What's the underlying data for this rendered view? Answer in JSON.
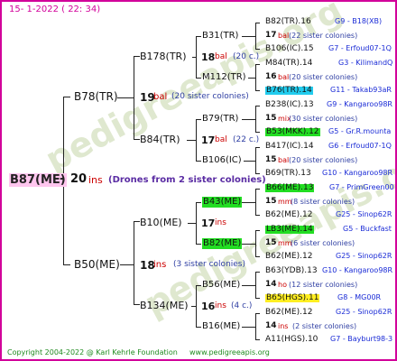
{
  "header": {
    "date": "15-  1-2022 ( 22: 34)"
  },
  "watermark": {
    "bg_text": "pedigreeapis.org"
  },
  "subject": {
    "name": "B87(ME)",
    "number": "20",
    "sep": "-",
    "abbr": "ins",
    "note": "(Drones from 2 sister colonies)"
  },
  "gen1": [
    {
      "name": "B78(TR)",
      "number": "19",
      "abbr": "bal",
      "note": "(20 sister colonies)"
    },
    {
      "name": "B50(ME)",
      "number": "18",
      "abbr": "ins",
      "note": "(3 sister colonies)"
    }
  ],
  "gen2": [
    {
      "name": "B178(TR)",
      "number": "18",
      "abbr": "bal",
      "note": "(20 c.)"
    },
    {
      "name": "B84(TR)",
      "number": "17",
      "abbr": "bal",
      "note": "(22 c.)"
    },
    {
      "name": "B10(ME)",
      "number": "17",
      "abbr": "ins",
      "note": ""
    },
    {
      "name": "B134(ME)",
      "number": "16",
      "abbr": "ins",
      "note": "(4 c.)"
    }
  ],
  "gen3": [
    {
      "name": "B31(TR)"
    },
    {
      "name": "M112(TR)"
    },
    {
      "name": "B79(TR)"
    },
    {
      "name": "B106(IC)"
    },
    {
      "name": "B43(ME)"
    },
    {
      "name": "B82(ME)"
    },
    {
      "name": "B56(ME)"
    },
    {
      "name": "B16(ME)"
    }
  ],
  "gen4": [
    {
      "name": "B82(TR).16",
      "code": "G9 - B18(XB)"
    },
    {
      "number": "17",
      "abbr": "bal",
      "note": "(22 sister colonies)"
    },
    {
      "name": "B106(IC).15",
      "code": "G7 - Erfoud07-1Q"
    },
    {
      "name": "M84(TR).14",
      "code": "G3 - KilimandQ"
    },
    {
      "number": "16",
      "abbr": "bal",
      "note": "(20 sister colonies)"
    },
    {
      "name": "B76(TR).14",
      "code": "G11 - Takab93aR"
    },
    {
      "name": "B238(IC).13",
      "code": "G9 - Kangaroo98R"
    },
    {
      "number": "15",
      "abbr": "mix",
      "note": "(30 sister colonies)"
    },
    {
      "name": "B53(MKK).12",
      "code": "G5 - Gr.R.mounta"
    },
    {
      "name": "B417(IC).14",
      "code": "G6 - Erfoud07-1Q"
    },
    {
      "number": "15",
      "abbr": "bal",
      "note": "(20 sister colonies)"
    },
    {
      "name": "B69(TR).13",
      "code": "G10 - Kangaroo98R"
    },
    {
      "name": "B66(ME).13",
      "code": "G7 - PrimGreen00"
    },
    {
      "number": "15",
      "abbr": "mm",
      "note": "(8 sister colonies)"
    },
    {
      "name": "B62(ME).12",
      "code": "G25 - Sinop62R"
    },
    {
      "name": "LB3(ME).14",
      "code": "G5 - Buckfast"
    },
    {
      "number": "15",
      "abbr": "mm",
      "note": "(6 sister colonies)"
    },
    {
      "name": "B62(ME).12",
      "code": "G25 - Sinop62R"
    },
    {
      "name": "B63(YDB).13",
      "code": "G10 - Kangaroo98R"
    },
    {
      "number": "14",
      "abbr": "ho",
      "note": "(12 sister colonies)"
    },
    {
      "name": "B65(HGS).11",
      "code": "G8 - MG00R"
    },
    {
      "name": "B62(ME).12",
      "code": "G25 - Sinop62R"
    },
    {
      "number": "14",
      "abbr": "ins",
      "note": "(2 sister colonies)"
    },
    {
      "name": "A11(HGS).10",
      "code": "G7 - Bayburt98-3"
    }
  ],
  "footer": {
    "copyright": "Copyright 2004-2022 @ Karl Kehrle Foundation",
    "site": "www.pedigreeapis.org"
  },
  "colors": {
    "frame": "#d2009a",
    "codes": "#1a2bd6",
    "notes": "#2f3fa3",
    "abbr": "#cc0000",
    "green_hl": "#22dd22",
    "cyan_hl": "#22ccee",
    "yellow_hl": "#ffee22"
  }
}
